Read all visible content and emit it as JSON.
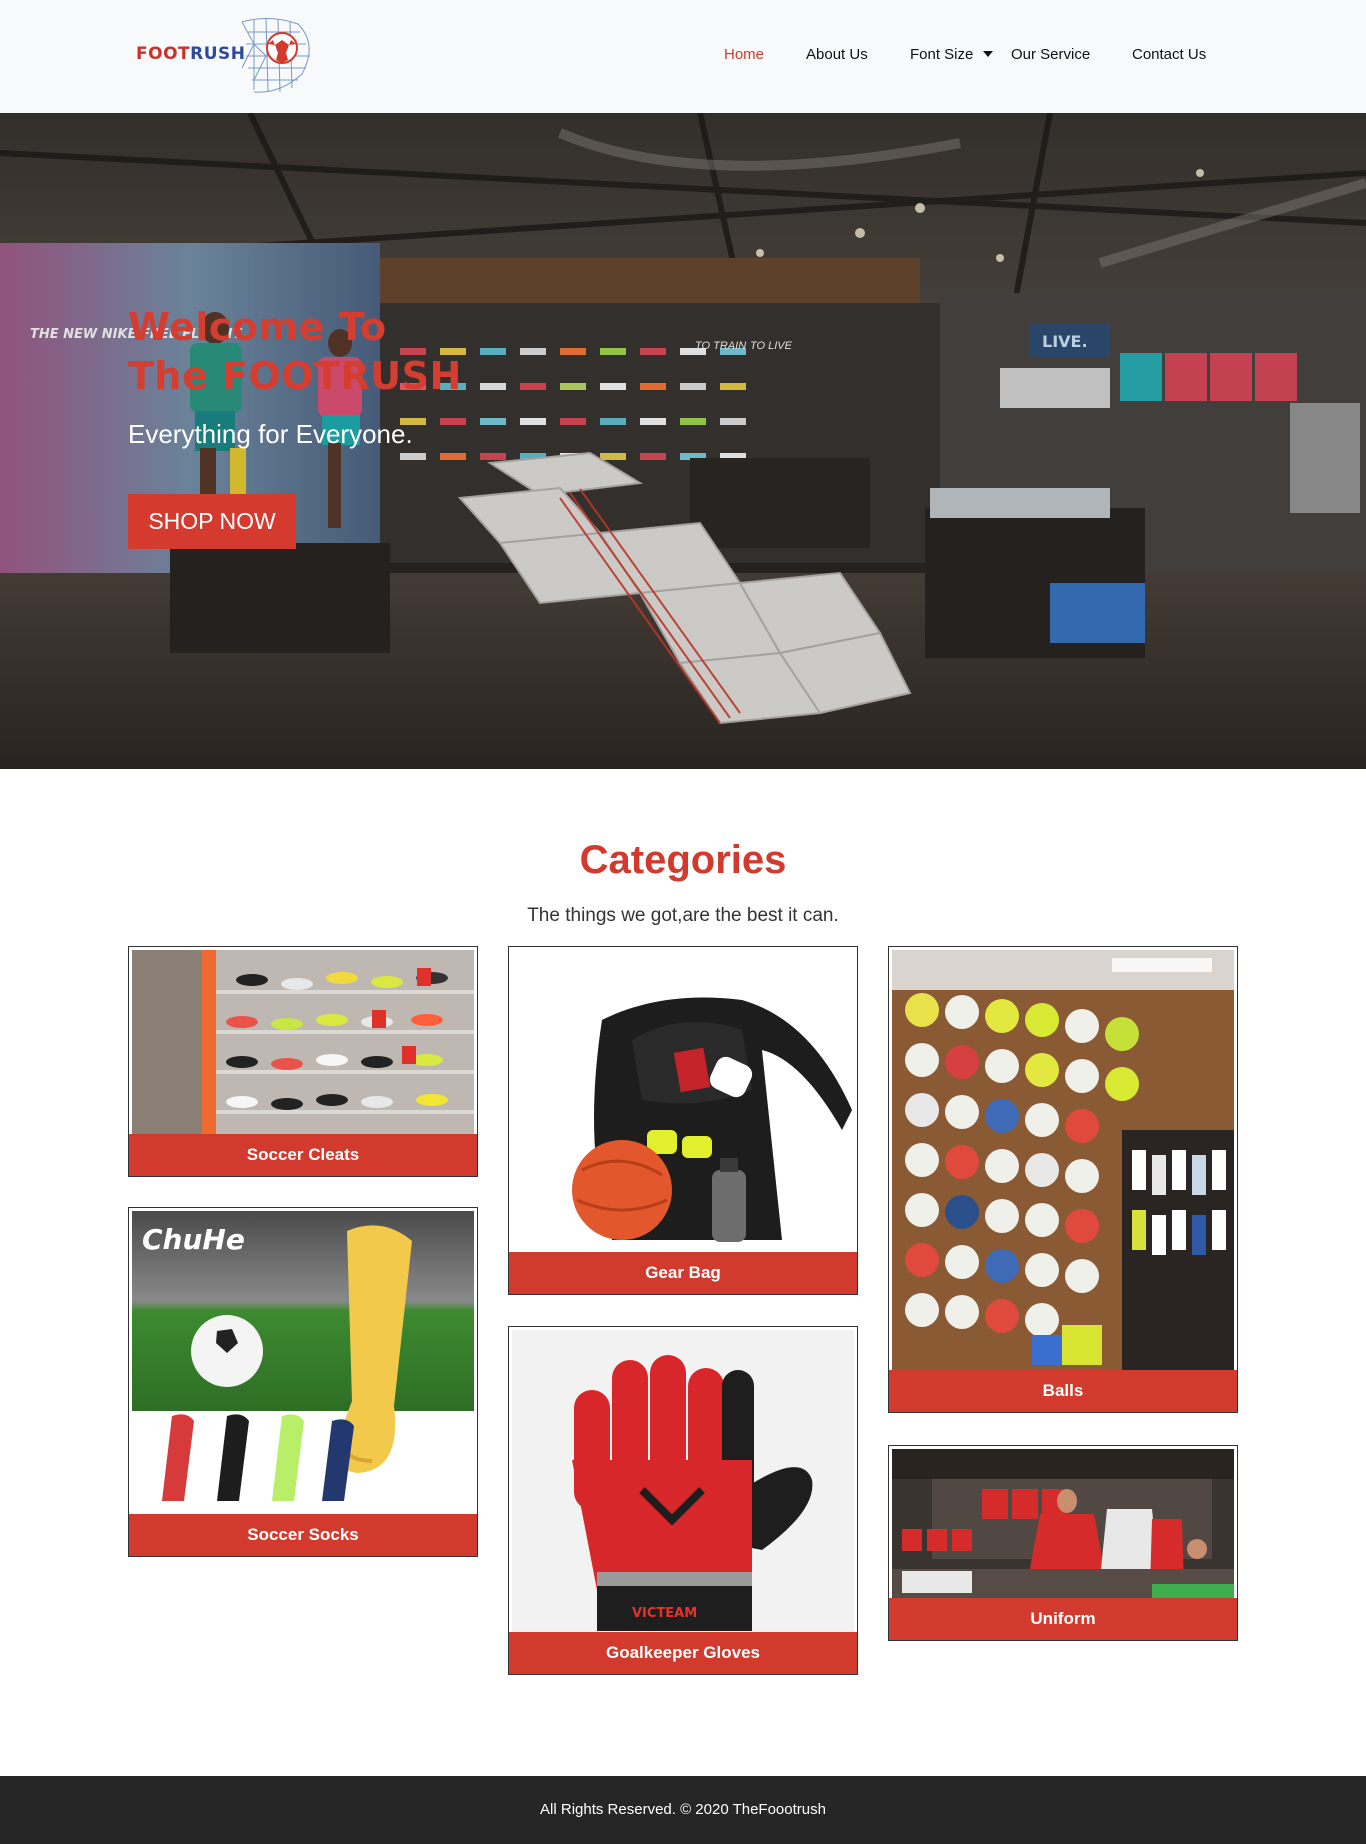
{
  "brand": {
    "logo_part1": "FOOT",
    "logo_part2": "RUSH",
    "primary_color": "#d13a2d",
    "logo_blue": "#2e4a9c"
  },
  "nav": {
    "items": [
      {
        "label": "Home",
        "active": true
      },
      {
        "label": "About Us"
      },
      {
        "label": "Font Size",
        "dropdown": true
      },
      {
        "label": "Our Service"
      },
      {
        "label": "Contact Us"
      }
    ]
  },
  "hero": {
    "title_line1": "Welcome To",
    "title_line2": "The FOOTRUSH",
    "subtitle": "Everything for Everyone.",
    "button_label": "SHOP NOW",
    "sign_texts": [
      "THE NEW NIKE FREE FLYKNIT",
      "TO TRAIN",
      "TO LIVE",
      "LIVE."
    ]
  },
  "categories": {
    "title": "Categories",
    "subtitle": "The things we got,are the best it can.",
    "items": [
      {
        "label": "Soccer Cleats"
      },
      {
        "label": "Gear Bag"
      },
      {
        "label": "Balls"
      },
      {
        "label": "Soccer Socks",
        "brand_text": "ChuHe"
      },
      {
        "label": "Goalkeeper Gloves",
        "brand_text": "VICTEAM"
      },
      {
        "label": "Uniform"
      }
    ]
  },
  "footer": {
    "text": "All Rights Reserved. © 2020 TheFoootrush"
  }
}
